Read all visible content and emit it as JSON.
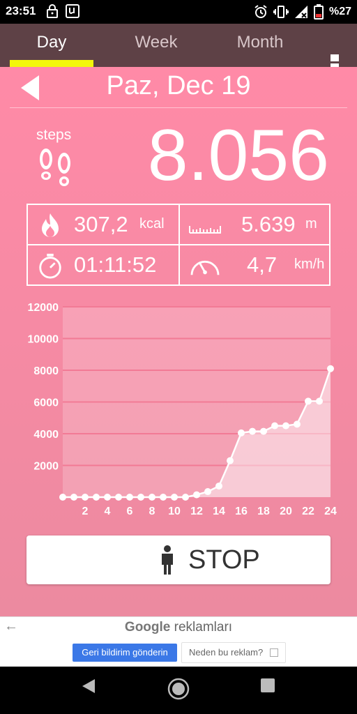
{
  "status_bar": {
    "time": "23:51",
    "battery": "%27"
  },
  "tabs": [
    {
      "label": "Day",
      "active": true
    },
    {
      "label": "Week",
      "active": false
    },
    {
      "label": "Month",
      "active": false
    }
  ],
  "header": {
    "date": "Paz, Dec 19"
  },
  "steps": {
    "label": "steps",
    "value": "8.056"
  },
  "stats": {
    "calories": {
      "value": "307,2",
      "unit": "kcal"
    },
    "distance": {
      "value": "5.639",
      "unit": "m"
    },
    "duration": {
      "value": "01:11:52"
    },
    "speed": {
      "value": "4,7",
      "unit": "km/h"
    }
  },
  "chart_data": {
    "type": "area",
    "x": [
      0,
      1,
      2,
      3,
      4,
      5,
      6,
      7,
      8,
      9,
      10,
      11,
      12,
      13,
      14,
      15,
      16,
      17,
      18,
      19,
      20,
      21,
      22,
      23,
      24
    ],
    "values": [
      0,
      0,
      0,
      0,
      0,
      0,
      0,
      0,
      0,
      0,
      0,
      0,
      150,
      350,
      700,
      2300,
      4050,
      4150,
      4150,
      4500,
      4500,
      4600,
      6050,
      6050,
      8100
    ],
    "x_ticks": [
      2,
      4,
      6,
      8,
      10,
      12,
      14,
      16,
      18,
      20,
      22,
      24
    ],
    "y_ticks": [
      2000,
      4000,
      6000,
      8000,
      10000,
      12000
    ],
    "ylim": [
      0,
      12000
    ],
    "xlim": [
      0,
      24
    ],
    "grid": true
  },
  "stop_button": {
    "label": "STOP"
  },
  "ad": {
    "brand": "Google",
    "title_suffix": "reklamları",
    "feedback_label": "Geri bildirim gönderin",
    "why_label": "Neden bu reklam?"
  },
  "colors": {
    "app_bar": "#5e4146",
    "tab_indicator": "#f3f70a",
    "background_pink": "#ff8aa7",
    "ad_button_blue": "#3b78e7"
  }
}
